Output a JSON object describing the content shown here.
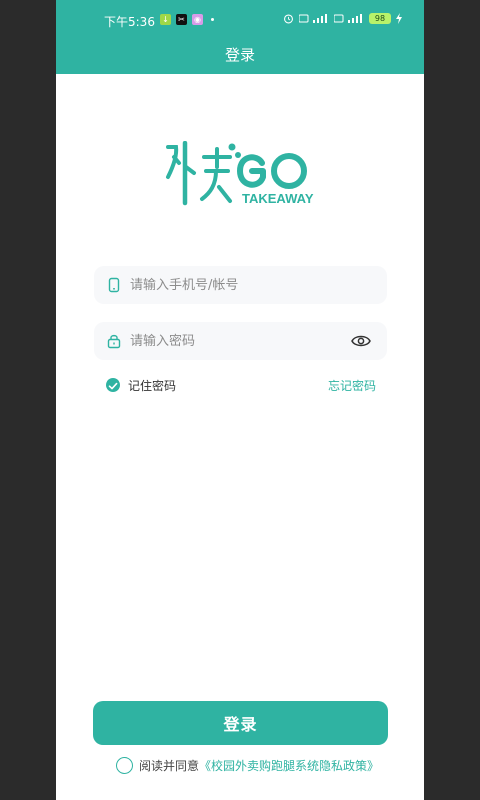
{
  "status_bar": {
    "time": "下午5:36",
    "battery": "98"
  },
  "header": {
    "title": "登录"
  },
  "logo": {
    "name": "外卖GO",
    "sub": "TAKEAWAY"
  },
  "form": {
    "account_placeholder": "请输入手机号/帐号",
    "password_placeholder": "请输入密码",
    "remember_label": "记住密码",
    "forgot_label": "忘记密码"
  },
  "actions": {
    "login_label": "登录"
  },
  "agreement": {
    "prefix": "阅读并同意",
    "policy": "《校园外卖购跑腿系统隐私政策》"
  },
  "colors": {
    "accent": "#2fb3a2"
  }
}
